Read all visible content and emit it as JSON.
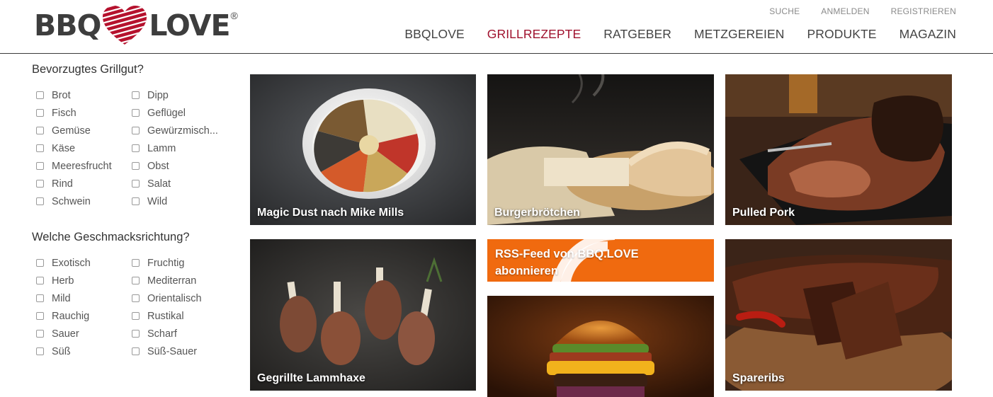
{
  "logo": {
    "left": "BBQ",
    "right": "LOVE",
    "registered": "®"
  },
  "util_nav": [
    "SUCHE",
    "ANMELDEN",
    "REGISTRIEREN"
  ],
  "main_nav": [
    {
      "label": "BBQLOVE",
      "active": false
    },
    {
      "label": "GRILLREZEPTE",
      "active": true
    },
    {
      "label": "RATGEBER",
      "active": false
    },
    {
      "label": "METZGEREIEN",
      "active": false
    },
    {
      "label": "PRODUKTE",
      "active": false
    },
    {
      "label": "MAGAZIN",
      "active": false
    }
  ],
  "filters": {
    "grillgut": {
      "title": "Bevorzugtes Grillgut?",
      "options": [
        "Brot",
        "Dipp",
        "Fisch",
        "Geflügel",
        "Gemüse",
        "Gewürzmisch...",
        "Käse",
        "Lamm",
        "Meeresfrucht",
        "Obst",
        "Rind",
        "Salat",
        "Schwein",
        "Wild"
      ]
    },
    "geschmack": {
      "title": "Welche Geschmacksrichtung?",
      "options": [
        "Exotisch",
        "Fruchtig",
        "Herb",
        "Mediterran",
        "Mild",
        "Orientalisch",
        "Rauchig",
        "Rustikal",
        "Sauer",
        "Scharf",
        "Süß",
        "Süß-Sauer"
      ]
    }
  },
  "tiles": {
    "magic_dust": "Magic Dust nach Mike Mills",
    "burgerbroetchen": "Burgerbrötchen",
    "pulled_pork": "Pulled Pork",
    "lammhaxe": "Gegrillte Lammhaxe",
    "rss": "RSS-Feed von BBQ.LOVE abonnieren",
    "burger": "",
    "spareribs": "Spareribs"
  },
  "colors": {
    "brand_red": "#a0122e",
    "rss_orange": "#f06a0f",
    "text_dark": "#333333"
  }
}
